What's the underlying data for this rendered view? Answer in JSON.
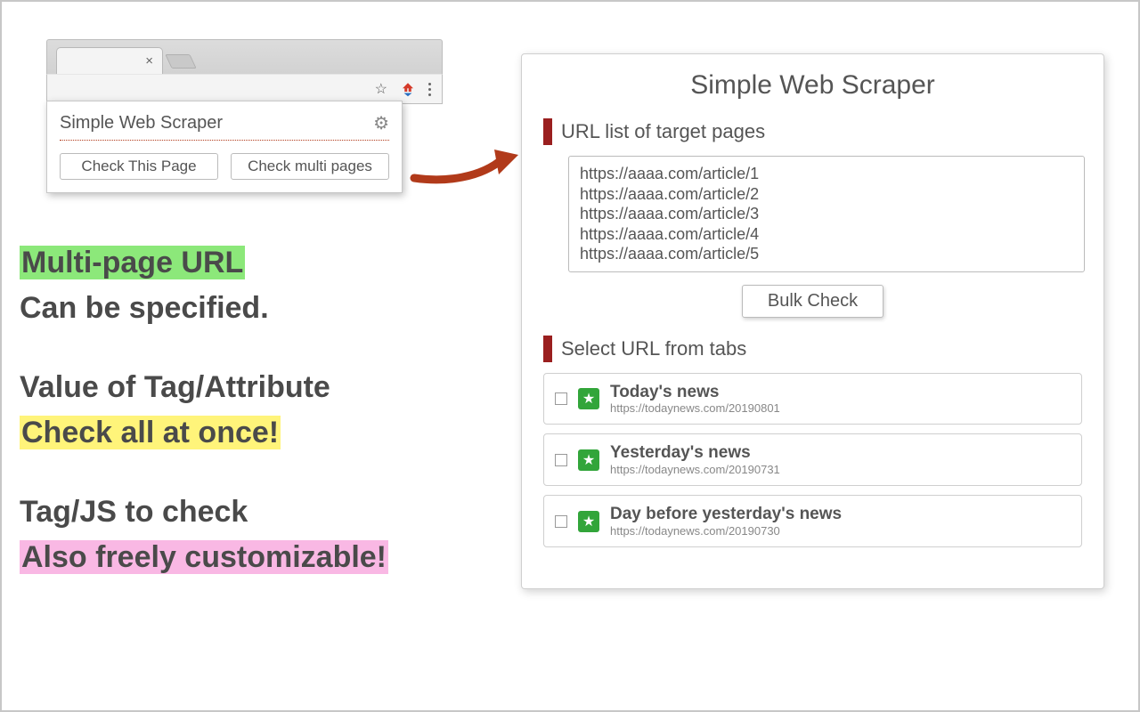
{
  "popup": {
    "title": "Simple Web Scraper",
    "check_this_page": "Check This Page",
    "check_multi_pages": "Check multi pages"
  },
  "marketing": {
    "l1": "Multi-page URL",
    "l2": "Can be specified.",
    "l3": "Value of Tag/Attribute",
    "l4": "Check all at once!",
    "l5": "Tag/JS to check",
    "l6": "Also freely customizable!"
  },
  "panel": {
    "title": "Simple Web Scraper",
    "url_list_heading": "URL list of target pages",
    "url_list_value": "https://aaaa.com/article/1\nhttps://aaaa.com/article/2\nhttps://aaaa.com/article/3\nhttps://aaaa.com/article/4\nhttps://aaaa.com/article/5",
    "bulk_check": "Bulk Check",
    "select_tabs_heading": "Select URL from tabs",
    "tabs": [
      {
        "title": "Today's news",
        "url": "https://todaynews.com/20190801",
        "checked": false
      },
      {
        "title": "Yesterday's news",
        "url": "https://todaynews.com/20190731",
        "checked": false
      },
      {
        "title": "Day before yesterday's news",
        "url": "https://todaynews.com/20190730",
        "checked": false
      }
    ]
  },
  "colors": {
    "accent_red": "#b13a1a",
    "highlight_green": "#8ce87a",
    "highlight_yellow": "#fff47a",
    "highlight_pink": "#f9b8e4",
    "favicon_green": "#32a53a"
  }
}
